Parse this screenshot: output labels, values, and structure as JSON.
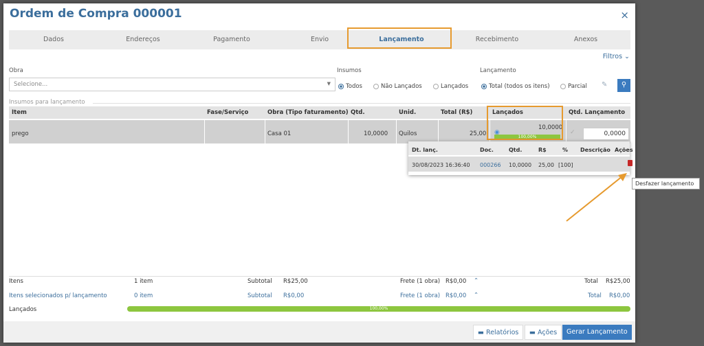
{
  "modal": {
    "title": "Ordem de Compra 000001",
    "close": "×"
  },
  "tabs": [
    "Dados",
    "Endereços",
    "Pagamento",
    "Envio",
    "Lançamento",
    "Recebimento",
    "Anexos"
  ],
  "filters": {
    "toggle": "Filtros ⌄",
    "obra_label": "Obra",
    "obra_placeholder": "Selecione...",
    "insumos_label": "Insumos",
    "insumos_options": [
      "Todos",
      "Não Lançados",
      "Lançados"
    ],
    "lancamento_label": "Lançamento",
    "lancamento_options": [
      "Total (todos os itens)",
      "Parcial"
    ]
  },
  "section_title": "Insumos para lançamento",
  "table": {
    "headers": [
      "Item",
      "Fase/Serviço",
      "Obra (Tipo faturamento)",
      "Qtd.",
      "Unid.",
      "Total (R$)",
      "Lançados",
      "Qtd. Lançamento"
    ],
    "row": {
      "item": "prego",
      "fase": "",
      "obra": "Casa 01",
      "qtd": "10,0000",
      "unid": "Quilos",
      "total": "25,00",
      "lancados": "10,0000",
      "lancados_pct": "100,00%",
      "lancados_fraction": 1.0,
      "qtd_lancamento": "0,0000"
    }
  },
  "popup": {
    "headers": [
      "Dt. lanç.",
      "Doc.",
      "Qtd.",
      "R$",
      "%",
      "Descrição",
      "Ações"
    ],
    "row": {
      "data": "30/08/2023 16:36:40",
      "doc": "000266",
      "qtd": "10,0000",
      "valor": "25,00",
      "pct": "[100]",
      "descricao": ""
    }
  },
  "tooltip": "Desfazer lançamento",
  "footer": {
    "itens_label": "Itens",
    "itens_count": "1 item",
    "subtotal_label": "Subtotal",
    "subtotal": "R$25,00",
    "frete_label": "Frete (1 obra)",
    "frete": "R$0,00",
    "total_label": "Total",
    "total": "R$25,00",
    "sel_label": "Itens selecionados p/ lançamento",
    "sel_count": "0 item",
    "sel_subtotal": "R$0,00",
    "sel_frete": "R$0,00",
    "sel_total": "R$0,00",
    "lancados_label": "Lançados",
    "lancados_pct": "100,00%",
    "lancados_fraction": 1.0
  },
  "buttons": {
    "relatorios": "Relatórios",
    "acoes": "Ações",
    "gerar": "Gerar Lançamento"
  },
  "colors": {
    "accent": "#3b6e9c",
    "highlight": "#e69a2e",
    "progress": "#8dc63f",
    "delete": "#c62828"
  }
}
